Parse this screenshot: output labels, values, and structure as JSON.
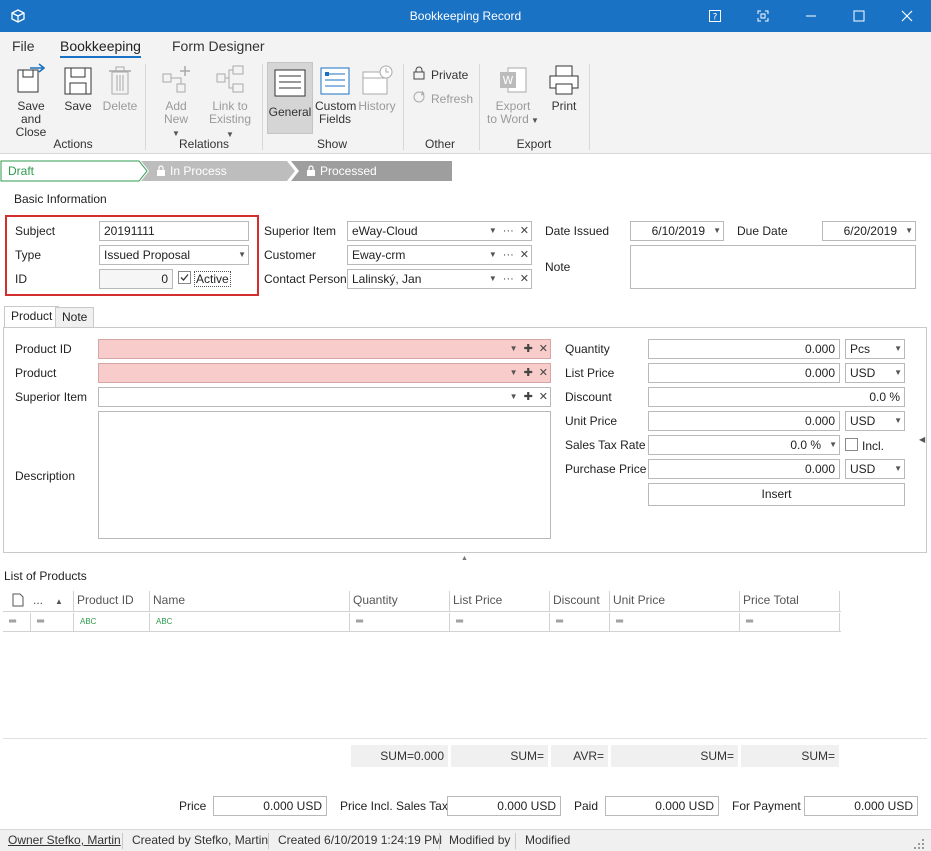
{
  "window": {
    "title": "Bookkeeping Record"
  },
  "menu": {
    "file": "File",
    "bookkeeping": "Bookkeeping",
    "form_designer": "Form Designer"
  },
  "ribbon": {
    "save_and_close": "Save and\nClose",
    "save": "Save",
    "delete": "Delete",
    "add_new": "Add New",
    "link_to_existing": "Link to\nExisting",
    "general": "General",
    "custom_fields": "Custom\nFields",
    "history": "History",
    "private": "Private",
    "refresh": "Refresh",
    "export_to_word": "Export\nto Word",
    "print": "Print",
    "groups": {
      "actions": "Actions",
      "relations": "Relations",
      "show": "Show",
      "other": "Other",
      "export": "Export"
    }
  },
  "workflow": {
    "draft": "Draft",
    "in_process": "In Process",
    "processed": "Processed"
  },
  "basic_info": {
    "title": "Basic Information",
    "subject_label": "Subject",
    "subject_value": "20191111",
    "type_label": "Type",
    "type_value": "Issued Proposal",
    "id_label": "ID",
    "id_value": "0",
    "active_label": "Active",
    "superior_item_label": "Superior Item",
    "superior_item_value": "eWay-Cloud",
    "customer_label": "Customer",
    "customer_value": "Eway-crm",
    "contact_person_label": "Contact Person",
    "contact_person_value": "Lalinský, Jan",
    "date_issued_label": "Date Issued",
    "date_issued_value": "6/10/2019",
    "due_date_label": "Due Date",
    "due_date_value": "6/20/2019",
    "note_label": "Note"
  },
  "tabs": {
    "product": "Product",
    "note": "Note"
  },
  "product": {
    "product_id_label": "Product ID",
    "product_label": "Product",
    "superior_item_label": "Superior Item",
    "description_label": "Description",
    "quantity_label": "Quantity",
    "quantity_value": "0.000",
    "quantity_unit": "Pcs",
    "list_price_label": "List Price",
    "list_price_value": "0.000",
    "list_price_currency": "USD",
    "discount_label": "Discount",
    "discount_value": "0.0 %",
    "unit_price_label": "Unit Price",
    "unit_price_value": "0.000",
    "unit_price_currency": "USD",
    "sales_tax_label": "Sales Tax Rate",
    "sales_tax_value": "0.0 %",
    "incl_label": "Incl.",
    "purchase_price_label": "Purchase Price",
    "purchase_price_value": "0.000",
    "purchase_price_currency": "USD",
    "insert_button": "Insert"
  },
  "list": {
    "title": "List of Products",
    "columns": {
      "ellipsis": "...",
      "product_id": "Product ID",
      "name": "Name",
      "quantity": "Quantity",
      "list_price": "List Price",
      "discount": "Discount",
      "unit_price": "Unit Price",
      "price_total": "Price Total"
    },
    "sums": {
      "quantity": "SUM=0.000",
      "list_price": "SUM=",
      "discount": "AVR=",
      "unit_price": "SUM=",
      "price_total": "SUM="
    }
  },
  "totals": {
    "price_label": "Price",
    "price_value": "0.000 USD",
    "price_incl_label": "Price Incl. Sales Tax",
    "price_incl_value": "0.000 USD",
    "paid_label": "Paid",
    "paid_value": "0.000 USD",
    "for_payment_label": "For Payment",
    "for_payment_value": "0.000 USD"
  },
  "status": {
    "owner": "Owner Stefko, Martin",
    "created_by": "Created by Stefko, Martin",
    "created": "Created 6/10/2019 1:24:19 PM",
    "modified_by": "Modified by",
    "modified": "Modified"
  },
  "colors": {
    "accent": "#1a72c4",
    "required": "#f9cccc",
    "highlight_border": "#d32f2f",
    "workflow_active": "#2e9b4e"
  }
}
